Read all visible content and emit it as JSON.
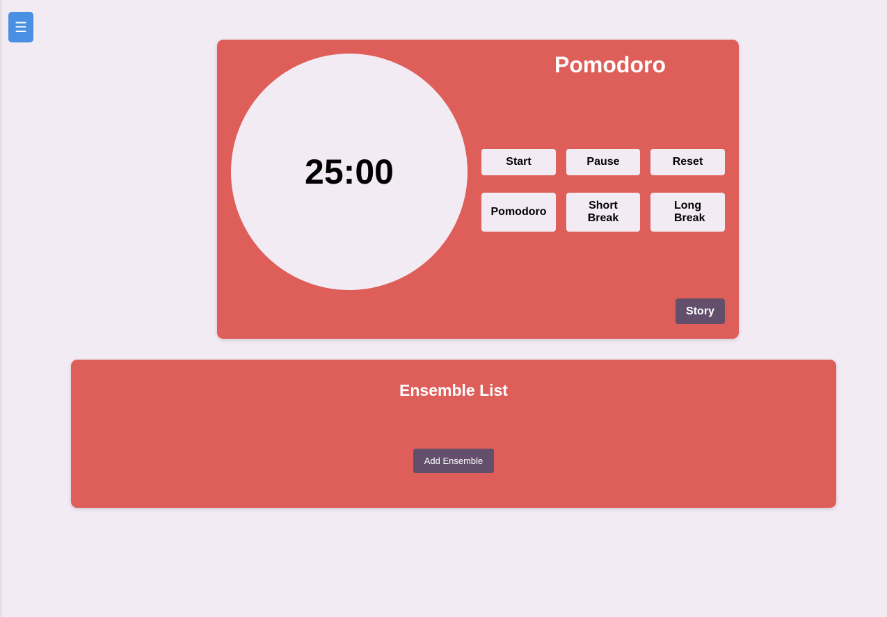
{
  "menu": {
    "icon": "hamburger-menu-icon",
    "glyph": "☰"
  },
  "timer": {
    "title": "Pomodoro",
    "time": "25:00",
    "controls": {
      "start": "Start",
      "pause": "Pause",
      "reset": "Reset"
    },
    "modes": {
      "pomodoro": "Pomodoro",
      "short_break": "Short Break",
      "long_break": "Long Break"
    },
    "story": "Story"
  },
  "ensemble": {
    "title": "Ensemble List",
    "add": "Add Ensemble"
  },
  "colors": {
    "card": "#de5e59",
    "background": "#f3ebf4",
    "accent": "#634f6b",
    "menu": "#4a90e2"
  }
}
